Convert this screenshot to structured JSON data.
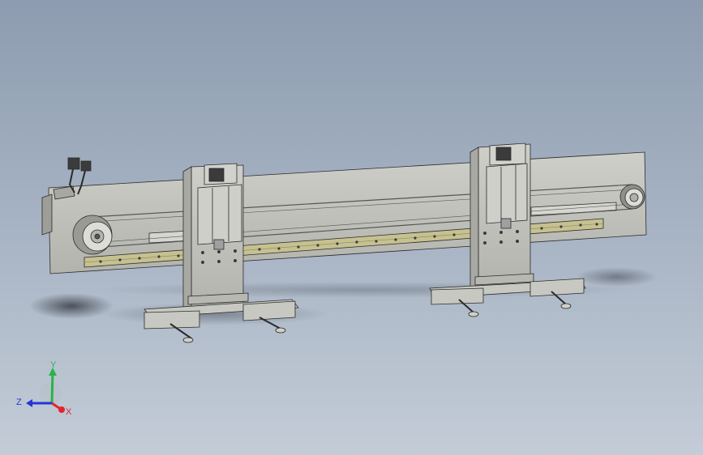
{
  "viewport": {
    "background_top": "#8d9cb0",
    "background_bottom": "#c3ccd7"
  },
  "model": {
    "part_color": "#c2c2bc",
    "edge_color": "#2a2a2a",
    "rail_color": "#bdb88c",
    "pulley_color": "#d8d8d8"
  },
  "triad": {
    "x_label": "X",
    "y_label": "Y",
    "z_label": "Z",
    "x_color": "#e0262a",
    "y_color": "#29b34a",
    "z_color": "#2436d6"
  }
}
